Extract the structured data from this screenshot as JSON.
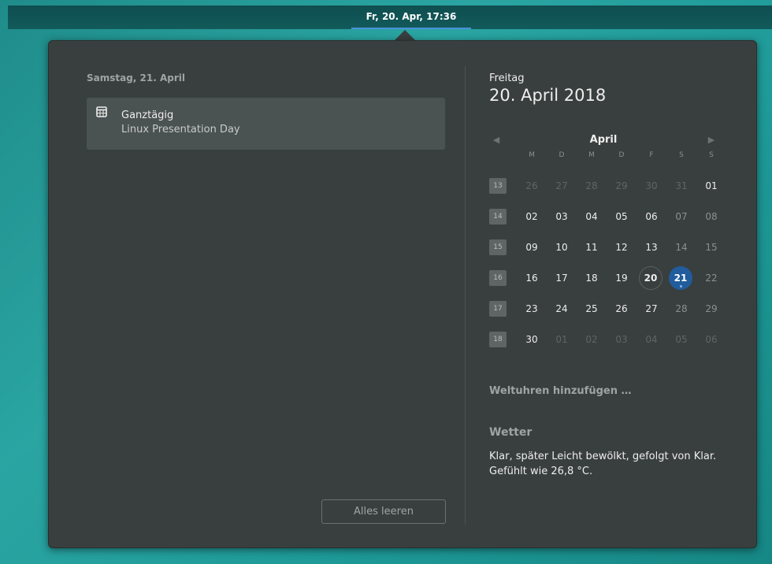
{
  "topbar": {
    "clock": "Fr, 20. Apr, 17:36"
  },
  "notifications": {
    "day_title": "Samstag, 21. April",
    "event": {
      "time": "Ganztägig",
      "title": "Linux Presentation Day",
      "icon": "calendar-icon"
    },
    "clear_button": "Alles leeren"
  },
  "calendar": {
    "weekday": "Freitag",
    "full_date": "20. April 2018",
    "month": "April",
    "prev_icon": "◀",
    "next_icon": "▶",
    "day_headers": [
      "M",
      "D",
      "M",
      "D",
      "F",
      "S",
      "S"
    ],
    "weeks": [
      {
        "week": "13",
        "days": [
          "26",
          "27",
          "28",
          "29",
          "30",
          "31",
          "01"
        ]
      },
      {
        "week": "14",
        "days": [
          "02",
          "03",
          "04",
          "05",
          "06",
          "07",
          "08"
        ]
      },
      {
        "week": "15",
        "days": [
          "09",
          "10",
          "11",
          "12",
          "13",
          "14",
          "15"
        ]
      },
      {
        "week": "16",
        "days": [
          "16",
          "17",
          "18",
          "19",
          "20",
          "21",
          "22"
        ]
      },
      {
        "week": "17",
        "days": [
          "23",
          "24",
          "25",
          "26",
          "27",
          "28",
          "29"
        ]
      },
      {
        "week": "18",
        "days": [
          "30",
          "01",
          "02",
          "03",
          "04",
          "05",
          "06"
        ]
      }
    ],
    "today": "20",
    "selected": "21",
    "accent_color": "#215d9c"
  },
  "world_clocks": "Weltuhren hinzufügen …",
  "weather": {
    "title": "Wetter",
    "text": "Klar, später Leicht bewölkt, gefolgt von Klar. Gefühlt wie 26,8 °C."
  }
}
